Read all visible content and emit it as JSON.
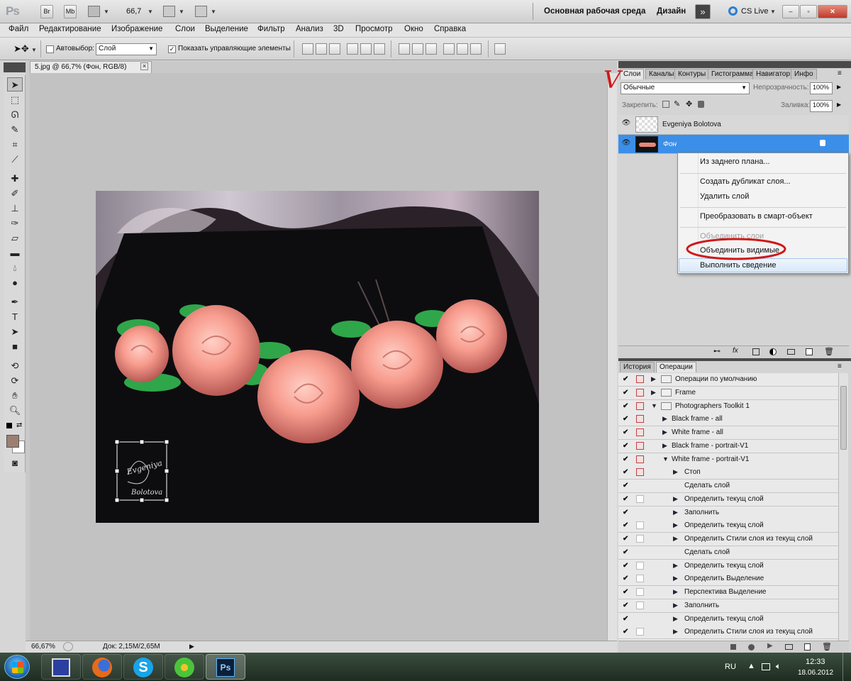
{
  "app": {
    "logo": "Ps",
    "bridge_label": "Br",
    "minibridge_label": "Mb",
    "zoom_value": "66,7",
    "workspace_label": "Основная рабочая среда",
    "design_label": "Дизайн",
    "cslive_label": "CS Live"
  },
  "menu": [
    "Файл",
    "Редактирование",
    "Изображение",
    "Слои",
    "Выделение",
    "Фильтр",
    "Анализ",
    "3D",
    "Просмотр",
    "Окно",
    "Справка"
  ],
  "options": {
    "autoselect_label": "Автовыбор:",
    "autoselect_value": "Слой",
    "show_controls_label": "Показать управляющие элементы",
    "show_controls_checked": "✓"
  },
  "document": {
    "tab_title": "5.jpg @ 66,7% (Фон, RGB/8)",
    "tab_close": "×",
    "watermark_text_1": "Evgeniya",
    "watermark_text_2": "Bolotova"
  },
  "status": {
    "zoom": "66,67%",
    "doc_size": "Док: 2,15M/2,65M"
  },
  "layers_panel": {
    "tabs": [
      "Слои",
      "Каналы",
      "Контуры",
      "Гистограмма",
      "Навигатор",
      "Инфо"
    ],
    "blend_mode": "Обычные",
    "opacity_label": "Непрозрачность:",
    "opacity_value": "100%",
    "lock_label": "Закрепить:",
    "fill_label": "Заливка:",
    "fill_value": "100%",
    "layers": [
      {
        "name": "Evgeniya Bolotova"
      },
      {
        "name": "Фон"
      }
    ]
  },
  "context_menu": {
    "items": [
      "Из заднего плана...",
      "Создать дубликат слоя...",
      "Удалить слой",
      "Преобразовать в смарт-объект",
      "Объединить слои",
      "Объединить видимые",
      "Выполнить сведение"
    ]
  },
  "actions_panel": {
    "tabs": [
      "История",
      "Операции"
    ],
    "rows": [
      {
        "label": "Операции по умолчанию",
        "level": 0
      },
      {
        "label": "Frame",
        "level": 0
      },
      {
        "label": "Photographers Toolkit 1",
        "level": 0
      },
      {
        "label": "Black frame - all",
        "level": 1
      },
      {
        "label": "White frame - all",
        "level": 1
      },
      {
        "label": "Black frame - portrait-V1",
        "level": 1
      },
      {
        "label": "White frame - portrait-V1",
        "level": 1
      },
      {
        "label": "Стоп",
        "level": 2
      },
      {
        "label": "Сделать слой",
        "level": 2
      },
      {
        "label": "Определить текущ слой",
        "level": 2
      },
      {
        "label": "Заполнить",
        "level": 2
      },
      {
        "label": "Определить текущ слой",
        "level": 2
      },
      {
        "label": "Определить Стили слоя из текущ слой",
        "level": 2
      },
      {
        "label": "Сделать слой",
        "level": 2
      },
      {
        "label": "Определить текущ слой",
        "level": 2
      },
      {
        "label": "Определить Выделение",
        "level": 2
      },
      {
        "label": "Перспектива Выделение",
        "level": 2
      },
      {
        "label": "Заполнить",
        "level": 2
      },
      {
        "label": "Определить текущ слой",
        "level": 2
      },
      {
        "label": "Определить Стили слоя из текущ слой",
        "level": 2
      }
    ]
  },
  "taskbar": {
    "lang": "RU",
    "time": "12:33",
    "date": "18.06.2012",
    "ps_label": "Ps"
  },
  "annotation": {
    "checkmark": "V"
  }
}
